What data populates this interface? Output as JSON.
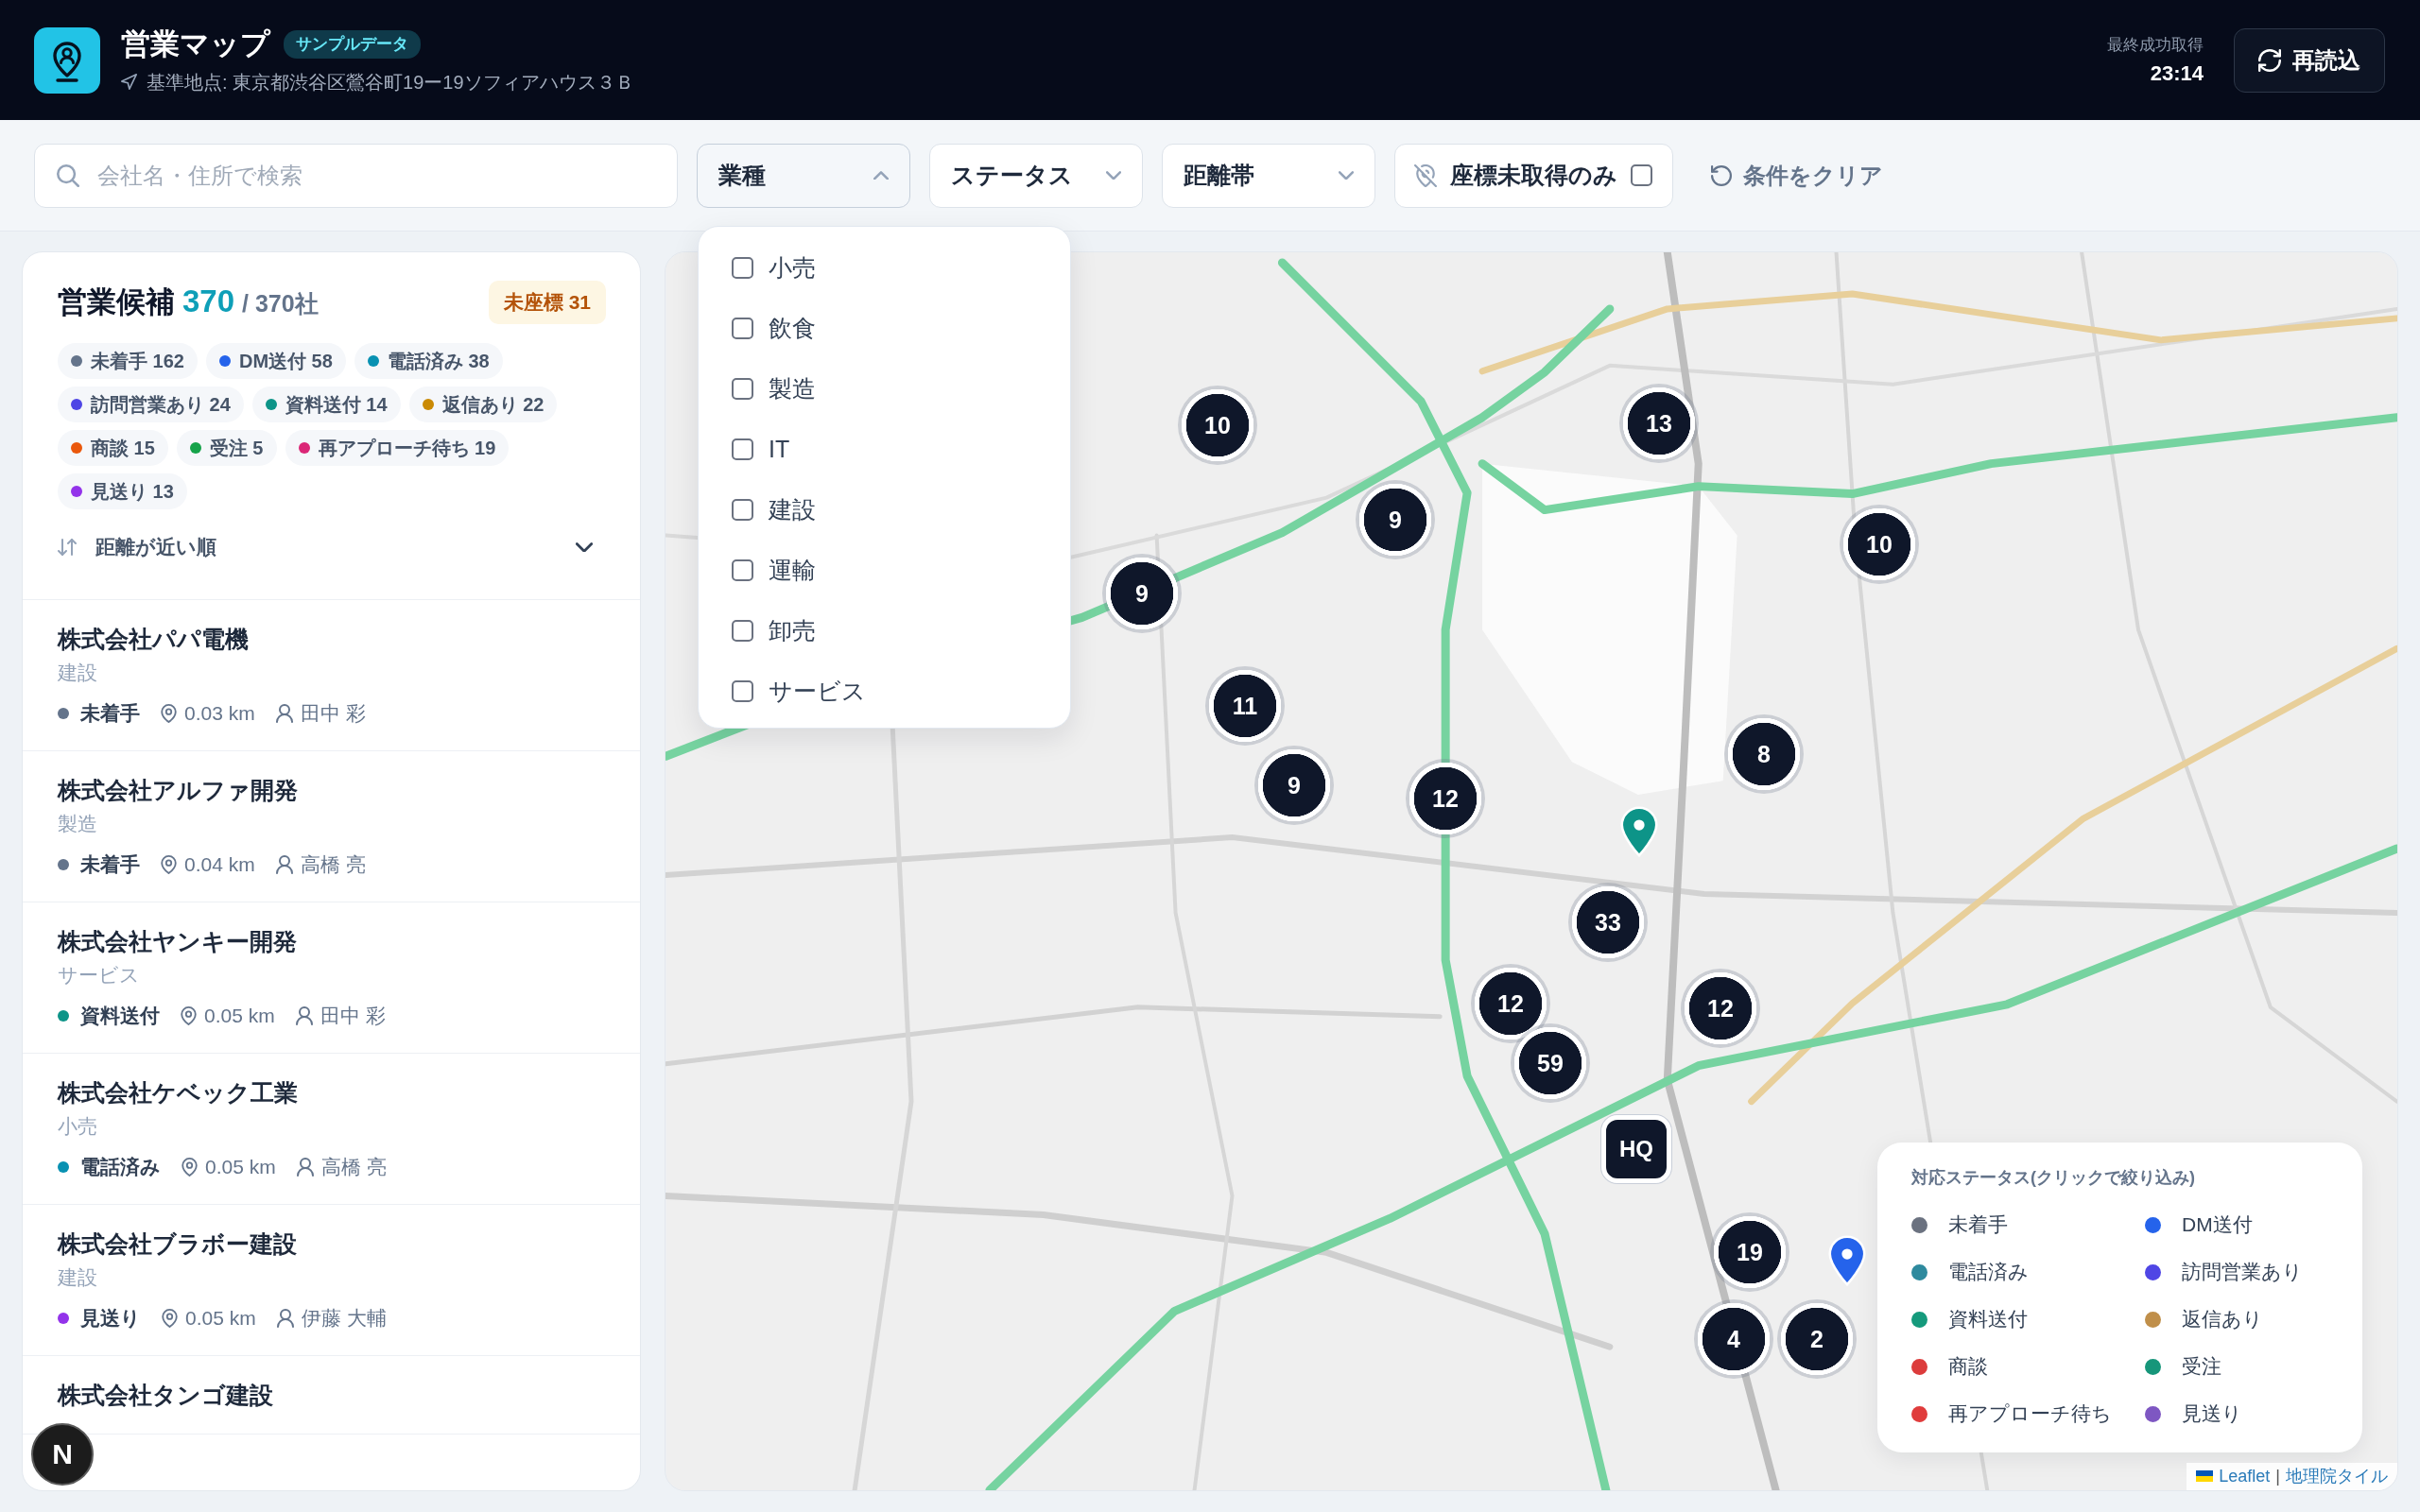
{
  "header": {
    "title": "営業マップ",
    "badge": "サンプルデータ",
    "base_location": "基準地点: 東京都渋谷区鶯谷町19ー19ソフィアハウス３Ｂ",
    "last_fetch_label": "最終成功取得",
    "last_fetch_time": "23:14",
    "reload_button": "再読込"
  },
  "filters": {
    "search": {
      "placeholder": "会社名・住所で検索"
    },
    "dropdowns": [
      {
        "label": "業種",
        "expanded": true,
        "options": [
          {
            "label": "小売",
            "checked": false
          },
          {
            "label": "飲食",
            "checked": false
          },
          {
            "label": "製造",
            "checked": false
          },
          {
            "label": "IT",
            "checked": false
          },
          {
            "label": "建設",
            "checked": false
          },
          {
            "label": "運輸",
            "checked": false
          },
          {
            "label": "卸売",
            "checked": false
          },
          {
            "label": "サービス",
            "checked": false
          }
        ]
      },
      {
        "label": "ステータス",
        "expanded": false
      },
      {
        "label": "距離帯",
        "expanded": false
      }
    ],
    "missing_coords": {
      "label": "座標未取得のみ",
      "checked": false
    },
    "clear_button": "条件をクリア"
  },
  "candidates": {
    "title": "営業候補",
    "shown": "370",
    "total": "/ 370社",
    "no_coords_badge": "未座標 31",
    "status_counts": [
      {
        "label": "未着手 162",
        "color": "#64748b"
      },
      {
        "label": "DM送付 58",
        "color": "#2563eb"
      },
      {
        "label": "電話済み 38",
        "color": "#0891b2"
      },
      {
        "label": "訪問営業あり 24",
        "color": "#4f46e5"
      },
      {
        "label": "資料送付 14",
        "color": "#0d9488"
      },
      {
        "label": "返信あり 22",
        "color": "#ca8a04"
      },
      {
        "label": "商談 15",
        "color": "#ea580c"
      },
      {
        "label": "受注 5",
        "color": "#16a34a"
      },
      {
        "label": "再アプローチ待ち 19",
        "color": "#db2777"
      },
      {
        "label": "見送り 13",
        "color": "#9333ea"
      }
    ],
    "sort": {
      "label": "距離が近い順"
    },
    "companies": [
      {
        "name": "株式会社パパ電機",
        "industry": "建設",
        "status": "未着手",
        "color": "#64748b",
        "distance": "0.03 km",
        "assignee": "田中 彩"
      },
      {
        "name": "株式会社アルファ開発",
        "industry": "製造",
        "status": "未着手",
        "color": "#64748b",
        "distance": "0.04 km",
        "assignee": "高橋 亮"
      },
      {
        "name": "株式会社ヤンキー開発",
        "industry": "サービス",
        "status": "資料送付",
        "color": "#0d9488",
        "distance": "0.05 km",
        "assignee": "田中 彩"
      },
      {
        "name": "株式会社ケベック工業",
        "industry": "小売",
        "status": "電話済み",
        "color": "#0891b2",
        "distance": "0.05 km",
        "assignee": "高橋 亮"
      },
      {
        "name": "株式会社ブラボー建設",
        "industry": "建設",
        "status": "見送り",
        "color": "#9333ea",
        "distance": "0.05 km",
        "assignee": "伊藤 大輔"
      },
      {
        "name": "株式会社タンゴ建設"
      }
    ]
  },
  "map": {
    "clusters": [
      {
        "count": "13"
      },
      {
        "count": "10"
      },
      {
        "count": "9"
      },
      {
        "count": "10"
      },
      {
        "count": "9"
      },
      {
        "count": "11"
      },
      {
        "count": "8"
      },
      {
        "count": "9"
      },
      {
        "count": "12"
      },
      {
        "count": "33"
      },
      {
        "count": "12"
      },
      {
        "count": "12"
      },
      {
        "count": "59"
      },
      {
        "count": "19"
      },
      {
        "count": "4"
      },
      {
        "count": "2"
      }
    ],
    "hq_marker": {
      "label": "HQ"
    },
    "pins": [
      {
        "color": "#0d9488"
      },
      {
        "color": "#2563eb"
      }
    ],
    "legend": {
      "title": "対応ステータス(クリックで絞り込み)",
      "items": [
        {
          "label": "未着手",
          "color": "#6b7280"
        },
        {
          "label": "DM送付",
          "color": "#2563eb"
        },
        {
          "label": "電話済み",
          "color": "#2e8a9e"
        },
        {
          "label": "訪問営業あり",
          "color": "#4f46e5"
        },
        {
          "label": "資料送付",
          "color": "#159a7c"
        },
        {
          "label": "返信あり",
          "color": "#c08f4a"
        },
        {
          "label": "商談",
          "color": "#dc3c3c"
        },
        {
          "label": "受注",
          "color": "#16967a"
        },
        {
          "label": "再アプローチ待ち",
          "color": "#e03c3c"
        },
        {
          "label": "見送り",
          "color": "#7e57c2"
        }
      ]
    },
    "attribution": {
      "leaflet": "Leaflet",
      "separator": "|",
      "tiles": "地理院タイル"
    }
  },
  "dev_indicator": {
    "label": "N"
  }
}
